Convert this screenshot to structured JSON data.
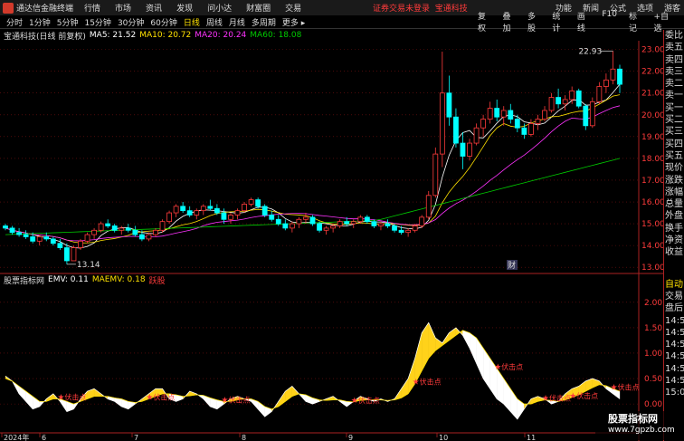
{
  "titlebar": {
    "app_name": "通达信金融终端",
    "menus": [
      "行情",
      "市场",
      "资讯",
      "发现",
      "问小达",
      "财富圈",
      "交易"
    ],
    "warning_1": "证券交易未登录",
    "warning_2": "宝通科技",
    "right_items": [
      "功能",
      "新闻",
      "公式",
      "选项",
      "游客"
    ]
  },
  "toolbar": {
    "periods": [
      "分时",
      "1分钟",
      "5分钟",
      "15分钟",
      "30分钟",
      "60分钟",
      "日线",
      "周线",
      "月线",
      "多周期",
      "更多"
    ],
    "active_period": "日线",
    "tools": [
      "复权",
      "叠加",
      "多股",
      "统计",
      "画线",
      "F10",
      "标记",
      "+自选"
    ]
  },
  "price_panel": {
    "stock_label": "宝通科技(日线 前复权)",
    "ma5": "MA5: 21.52",
    "ma10": "MA10: 20.72",
    "ma20": "MA20: 20.24",
    "ma60": "MA60: 18.08",
    "high_label": "22.93",
    "low_label": "13.14",
    "y_ticks": [
      "23.00",
      "22.00",
      "21.00",
      "20.00",
      "19.00",
      "18.00",
      "17.00",
      "16.00",
      "15.00",
      "14.00",
      "13.00"
    ],
    "finance_badge": "财"
  },
  "indicator_panel": {
    "name": "股票指标网",
    "emv": "EMV: 0.11",
    "maemv": "MAEMV: 0.18",
    "tag": "跃股",
    "y_ticks": [
      "2.00",
      "1.50",
      "1.00",
      "0.50",
      "0.00"
    ],
    "signal_label": "伏击点",
    "x_labels": [
      "2024年",
      "6",
      "7",
      "8",
      "9",
      "10",
      "11"
    ]
  },
  "right_panel": {
    "items": [
      "委比",
      "卖五",
      "卖四",
      "卖三",
      "卖二",
      "卖一",
      "买一",
      "买二",
      "买三",
      "买四",
      "买五",
      "现价",
      "涨跌",
      "涨幅",
      "总量",
      "外盘",
      "换手",
      "净资",
      "收益"
    ],
    "lower_items": [
      "自动",
      "交易",
      "盘后",
      "14:5",
      "14:5",
      "14:5",
      "14:5",
      "14:5",
      "14:5",
      "15:0"
    ]
  },
  "watermark": {
    "line1": "股票指标网",
    "line2": "www.7gpzb.com"
  },
  "colors": {
    "up": "#ff3b3b",
    "down": "#00ffff",
    "ma5": "#ffffff",
    "ma10": "#ffe100",
    "ma20": "#ff33ff",
    "ma60": "#00cc00",
    "grid": "#7a1010"
  },
  "chart_data": {
    "type": "candlestick",
    "candles": [
      [
        14.9,
        15.0,
        14.7,
        14.8
      ],
      [
        14.8,
        14.9,
        14.5,
        14.6
      ],
      [
        14.6,
        14.8,
        14.4,
        14.5
      ],
      [
        14.5,
        14.7,
        14.3,
        14.4
      ],
      [
        14.4,
        14.6,
        14.1,
        14.2
      ],
      [
        14.2,
        14.5,
        14.0,
        14.4
      ],
      [
        14.4,
        14.6,
        14.2,
        14.3
      ],
      [
        14.3,
        14.4,
        14.0,
        14.1
      ],
      [
        14.1,
        14.3,
        13.8,
        13.9
      ],
      [
        13.9,
        14.1,
        13.14,
        13.3
      ],
      [
        13.3,
        14.0,
        13.3,
        13.9
      ],
      [
        13.9,
        14.3,
        13.8,
        14.2
      ],
      [
        14.2,
        14.6,
        14.1,
        14.5
      ],
      [
        14.5,
        14.8,
        14.3,
        14.7
      ],
      [
        14.7,
        15.1,
        14.6,
        15.0
      ],
      [
        15.0,
        15.2,
        14.8,
        14.9
      ],
      [
        14.9,
        15.0,
        14.6,
        14.7
      ],
      [
        14.7,
        14.9,
        14.5,
        14.8
      ],
      [
        14.8,
        15.0,
        14.6,
        14.7
      ],
      [
        14.7,
        14.9,
        14.4,
        14.5
      ],
      [
        14.5,
        14.7,
        14.2,
        14.3
      ],
      [
        14.3,
        14.6,
        14.2,
        14.5
      ],
      [
        14.5,
        14.8,
        14.4,
        14.7
      ],
      [
        14.7,
        15.2,
        14.6,
        15.1
      ],
      [
        15.1,
        15.6,
        15.0,
        15.5
      ],
      [
        15.5,
        15.9,
        15.3,
        15.8
      ],
      [
        15.8,
        16.0,
        15.5,
        15.6
      ],
      [
        15.6,
        15.8,
        15.3,
        15.4
      ],
      [
        15.4,
        15.7,
        15.2,
        15.6
      ],
      [
        15.6,
        15.9,
        15.4,
        15.8
      ],
      [
        15.8,
        16.1,
        15.6,
        15.7
      ],
      [
        15.7,
        15.9,
        15.4,
        15.5
      ],
      [
        15.5,
        15.7,
        15.0,
        15.2
      ],
      [
        15.2,
        15.5,
        15.0,
        15.4
      ],
      [
        15.4,
        15.7,
        15.2,
        15.6
      ],
      [
        15.6,
        16.0,
        15.5,
        15.9
      ],
      [
        15.9,
        16.2,
        15.8,
        16.1
      ],
      [
        16.1,
        16.2,
        15.7,
        15.8
      ],
      [
        15.8,
        15.9,
        15.3,
        15.4
      ],
      [
        15.4,
        15.6,
        15.1,
        15.2
      ],
      [
        15.2,
        15.4,
        14.9,
        15.0
      ],
      [
        15.0,
        15.2,
        14.7,
        14.8
      ],
      [
        14.8,
        15.1,
        14.6,
        15.0
      ],
      [
        15.0,
        15.3,
        14.8,
        15.2
      ],
      [
        15.2,
        15.5,
        15.0,
        15.3
      ],
      [
        15.3,
        15.4,
        14.9,
        15.0
      ],
      [
        15.0,
        15.1,
        14.6,
        14.7
      ],
      [
        14.7,
        14.9,
        14.5,
        14.8
      ],
      [
        14.8,
        15.0,
        14.6,
        14.9
      ],
      [
        14.9,
        15.2,
        14.8,
        15.1
      ],
      [
        15.1,
        15.3,
        14.9,
        15.0
      ],
      [
        15.0,
        15.2,
        14.8,
        15.1
      ],
      [
        15.1,
        15.4,
        15.0,
        15.3
      ],
      [
        15.3,
        15.4,
        15.0,
        15.1
      ],
      [
        15.1,
        15.2,
        14.8,
        14.9
      ],
      [
        14.9,
        15.1,
        14.7,
        15.0
      ],
      [
        15.0,
        15.2,
        14.8,
        14.9
      ],
      [
        14.9,
        15.0,
        14.6,
        14.7
      ],
      [
        14.7,
        14.9,
        14.5,
        14.6
      ],
      [
        14.6,
        14.8,
        14.4,
        14.7
      ],
      [
        14.7,
        15.0,
        14.6,
        14.9
      ],
      [
        14.9,
        15.4,
        14.8,
        15.3
      ],
      [
        15.3,
        16.5,
        15.2,
        16.3
      ],
      [
        16.3,
        18.5,
        16.2,
        18.2
      ],
      [
        18.2,
        22.9,
        17.6,
        21.0
      ],
      [
        21.0,
        21.8,
        19.5,
        19.9
      ],
      [
        19.9,
        20.3,
        18.5,
        18.7
      ],
      [
        18.7,
        19.2,
        17.5,
        18.1
      ],
      [
        18.1,
        18.9,
        17.9,
        18.7
      ],
      [
        18.7,
        19.6,
        18.6,
        19.4
      ],
      [
        19.4,
        20.0,
        19.0,
        19.8
      ],
      [
        19.8,
        20.6,
        19.6,
        20.3
      ],
      [
        20.3,
        20.7,
        19.7,
        19.9
      ],
      [
        19.9,
        20.4,
        19.5,
        20.2
      ],
      [
        20.2,
        20.5,
        19.6,
        19.8
      ],
      [
        19.8,
        20.0,
        19.2,
        19.4
      ],
      [
        19.4,
        19.6,
        18.9,
        19.1
      ],
      [
        19.1,
        19.8,
        19.0,
        19.6
      ],
      [
        19.6,
        20.0,
        19.3,
        19.8
      ],
      [
        19.8,
        20.4,
        19.7,
        20.2
      ],
      [
        20.2,
        21.0,
        20.1,
        20.8
      ],
      [
        20.8,
        21.2,
        20.3,
        20.5
      ],
      [
        20.5,
        20.9,
        20.2,
        20.7
      ],
      [
        20.7,
        21.3,
        20.5,
        21.1
      ],
      [
        21.1,
        21.2,
        20.3,
        20.4
      ],
      [
        20.4,
        20.5,
        19.3,
        19.5
      ],
      [
        19.5,
        20.8,
        19.4,
        20.6
      ],
      [
        20.6,
        21.5,
        20.5,
        21.3
      ],
      [
        21.3,
        21.9,
        21.0,
        21.6
      ],
      [
        21.6,
        22.93,
        21.4,
        22.1
      ],
      [
        22.1,
        22.3,
        21.0,
        21.4
      ]
    ],
    "ma_windows": [
      5,
      10,
      20,
      60
    ],
    "ylim": [
      12.8,
      23.4
    ],
    "emv": [
      0.55,
      0.45,
      0.2,
      0.05,
      -0.1,
      -0.05,
      0.1,
      0.2,
      0.05,
      -0.15,
      -0.1,
      0.1,
      0.25,
      0.3,
      0.2,
      0.1,
      0.05,
      -0.05,
      -0.1,
      0.0,
      0.1,
      0.2,
      0.3,
      0.3,
      0.1,
      0.05,
      0.1,
      0.25,
      0.2,
      0.1,
      -0.05,
      -0.1,
      0.0,
      0.1,
      0.15,
      0.1,
      0.05,
      -0.1,
      -0.25,
      -0.15,
      0.05,
      0.25,
      0.35,
      0.2,
      0.05,
      0.0,
      0.05,
      0.1,
      0.15,
      0.05,
      -0.05,
      0.05,
      0.15,
      0.1,
      0.05,
      0.1,
      0.05,
      0.1,
      0.3,
      0.5,
      0.9,
      1.4,
      1.6,
      1.3,
      1.2,
      1.4,
      1.5,
      1.35,
      1.1,
      0.8,
      0.5,
      0.3,
      0.1,
      0.0,
      -0.15,
      -0.3,
      -0.1,
      0.1,
      0.15,
      0.1,
      0.0,
      0.05,
      0.2,
      0.3,
      0.35,
      0.45,
      0.5,
      0.45,
      0.3,
      0.2,
      0.1
    ],
    "maemv": [
      0.5,
      0.45,
      0.35,
      0.25,
      0.15,
      0.05,
      0.05,
      0.1,
      0.1,
      0.05,
      0.0,
      0.05,
      0.1,
      0.15,
      0.15,
      0.15,
      0.12,
      0.1,
      0.05,
      0.03,
      0.05,
      0.1,
      0.15,
      0.2,
      0.2,
      0.18,
      0.15,
      0.16,
      0.18,
      0.17,
      0.12,
      0.08,
      0.05,
      0.05,
      0.08,
      0.1,
      0.1,
      0.05,
      -0.05,
      -0.1,
      -0.05,
      0.05,
      0.15,
      0.2,
      0.18,
      0.12,
      0.08,
      0.07,
      0.08,
      0.08,
      0.05,
      0.04,
      0.07,
      0.08,
      0.08,
      0.08,
      0.07,
      0.08,
      0.12,
      0.2,
      0.4,
      0.65,
      0.9,
      1.05,
      1.15,
      1.25,
      1.35,
      1.45,
      1.4,
      1.3,
      1.1,
      0.9,
      0.7,
      0.5,
      0.3,
      0.1,
      0.0,
      0.0,
      0.05,
      0.08,
      0.07,
      0.05,
      0.08,
      0.13,
      0.18,
      0.25,
      0.32,
      0.38,
      0.36,
      0.3,
      0.25
    ],
    "emv_ylim": [
      -0.55,
      2.3
    ],
    "signal_indices": [
      8,
      21,
      32,
      51,
      60,
      72,
      79,
      83,
      89
    ]
  }
}
